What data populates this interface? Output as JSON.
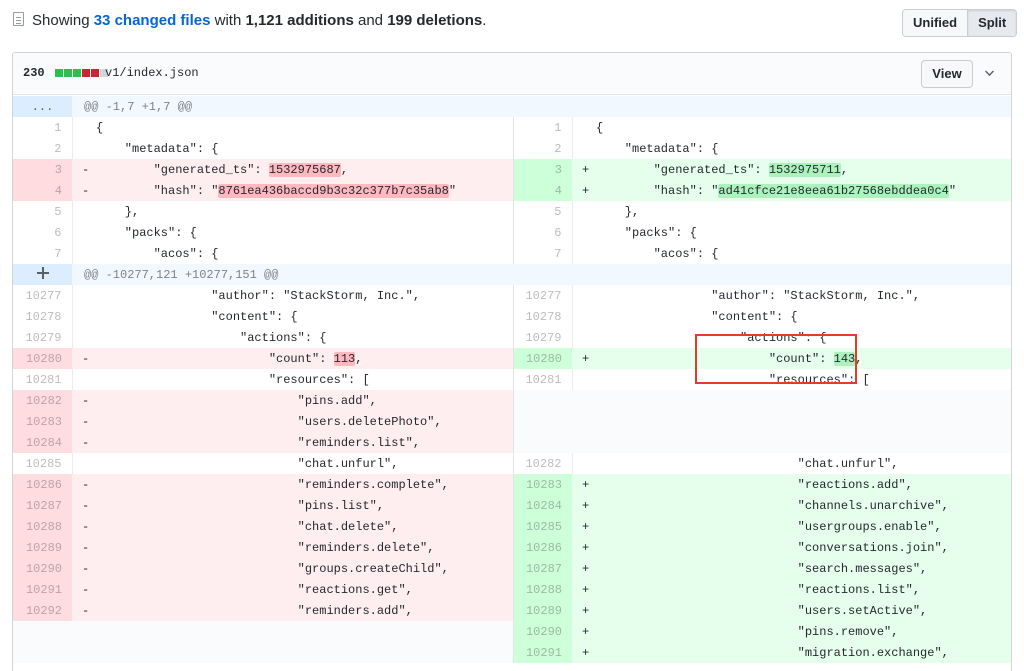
{
  "summary": {
    "prefix": "Showing ",
    "files_link": "33 changed files",
    "with": " with ",
    "additions": "1,121 additions",
    "and": " and ",
    "deletions": "199 deletions",
    "suffix": "."
  },
  "view_toggle": {
    "unified": "Unified",
    "split": "Split",
    "active": "Split"
  },
  "file": {
    "change_count": "230",
    "diffstat": [
      "green",
      "green",
      "green",
      "red",
      "red",
      "gray"
    ],
    "diffstat_colors": {
      "green": "#2cbe4e",
      "red": "#cb2431",
      "gray": "#d1d5da"
    },
    "path": "v1/index.json",
    "view_button": "View"
  },
  "hunks": [
    {
      "header": "@@ -1,7 +1,7 @@",
      "expander": "..."
    },
    {
      "header": "@@ -10277,121 +10277,151 @@",
      "expander": "expand-icon"
    }
  ],
  "rows": [
    {
      "type": "hunk",
      "hunk": 0
    },
    {
      "type": "ctx",
      "ln": "1",
      "rn": "1",
      "lc": "{",
      "rc": "{"
    },
    {
      "type": "ctx",
      "ln": "2",
      "rn": "2",
      "lc": "    \"metadata\": {",
      "rc": "    \"metadata\": {"
    },
    {
      "type": "chg",
      "ln": "3",
      "rn": "3",
      "lc_pre": "        \"generated_ts\": ",
      "lc_hl": "1532975687",
      "lc_post": ",",
      "rc_pre": "        \"generated_ts\": ",
      "rc_hl": "1532975711",
      "rc_post": ","
    },
    {
      "type": "chg",
      "ln": "4",
      "rn": "4",
      "lc_pre": "        \"hash\": \"",
      "lc_hl": "8761ea436baccd9b3c32c377b7c35ab8",
      "lc_post": "\"",
      "rc_pre": "        \"hash\": \"",
      "rc_hl": "ad41cfce21e8eea61b27568ebddea0c4",
      "rc_post": "\""
    },
    {
      "type": "ctx",
      "ln": "5",
      "rn": "5",
      "lc": "    },",
      "rc": "    },"
    },
    {
      "type": "ctx",
      "ln": "6",
      "rn": "6",
      "lc": "    \"packs\": {",
      "rc": "    \"packs\": {"
    },
    {
      "type": "ctx",
      "ln": "7",
      "rn": "7",
      "lc": "        \"acos\": {",
      "rc": "        \"acos\": {"
    },
    {
      "type": "hunk",
      "hunk": 1
    },
    {
      "type": "ctx",
      "ln": "10277",
      "rn": "10277",
      "lc": "                \"author\": \"StackStorm, Inc.\",",
      "rc": "                \"author\": \"StackStorm, Inc.\","
    },
    {
      "type": "ctx",
      "ln": "10278",
      "rn": "10278",
      "lc": "                \"content\": {",
      "rc": "                \"content\": {"
    },
    {
      "type": "ctx",
      "ln": "10279",
      "rn": "10279",
      "lc": "                    \"actions\": {",
      "rc": "                    \"actions\": {"
    },
    {
      "type": "chg",
      "ln": "10280",
      "rn": "10280",
      "lc_pre": "                        \"count\": ",
      "lc_hl": "113",
      "lc_post": ",",
      "rc_pre": "                        \"count\": ",
      "rc_hl": "143",
      "rc_post": ","
    },
    {
      "type": "ctx",
      "ln": "10281",
      "rn": "10281",
      "lc": "                        \"resources\": [",
      "rc": "                        \"resources\": ["
    },
    {
      "type": "delonly",
      "ln": "10282",
      "lc": "                            \"pins.add\","
    },
    {
      "type": "delonly",
      "ln": "10283",
      "lc": "                            \"users.deletePhoto\","
    },
    {
      "type": "delonly",
      "ln": "10284",
      "lc": "                            \"reminders.list\","
    },
    {
      "type": "ctx",
      "ln": "10285",
      "rn": "10282",
      "lc": "                            \"chat.unfurl\",",
      "rc": "                            \"chat.unfurl\","
    },
    {
      "type": "chgp",
      "ln": "10286",
      "rn": "10283",
      "lc": "                            \"reminders.complete\",",
      "rc": "                            \"reactions.add\","
    },
    {
      "type": "chgp",
      "ln": "10287",
      "rn": "10284",
      "lc": "                            \"pins.list\",",
      "rc": "                            \"channels.unarchive\","
    },
    {
      "type": "chgp",
      "ln": "10288",
      "rn": "10285",
      "lc": "                            \"chat.delete\",",
      "rc": "                            \"usergroups.enable\","
    },
    {
      "type": "chgp",
      "ln": "10289",
      "rn": "10286",
      "lc": "                            \"reminders.delete\",",
      "rc": "                            \"conversations.join\","
    },
    {
      "type": "chgp",
      "ln": "10290",
      "rn": "10287",
      "lc": "                            \"groups.createChild\",",
      "rc": "                            \"search.messages\","
    },
    {
      "type": "chgp",
      "ln": "10291",
      "rn": "10288",
      "lc": "                            \"reactions.get\",",
      "rc": "                            \"reactions.list\","
    },
    {
      "type": "chgp",
      "ln": "10292",
      "rn": "10289",
      "lc": "                            \"reminders.add\",",
      "rc": "                            \"users.setActive\","
    },
    {
      "type": "addonly",
      "rn": "10290",
      "rc": "                            \"pins.remove\","
    },
    {
      "type": "addonly",
      "rn": "10291",
      "rc": "                            \"migration.exchange\","
    }
  ],
  "markers": {
    "del": "-",
    "add": "+"
  }
}
